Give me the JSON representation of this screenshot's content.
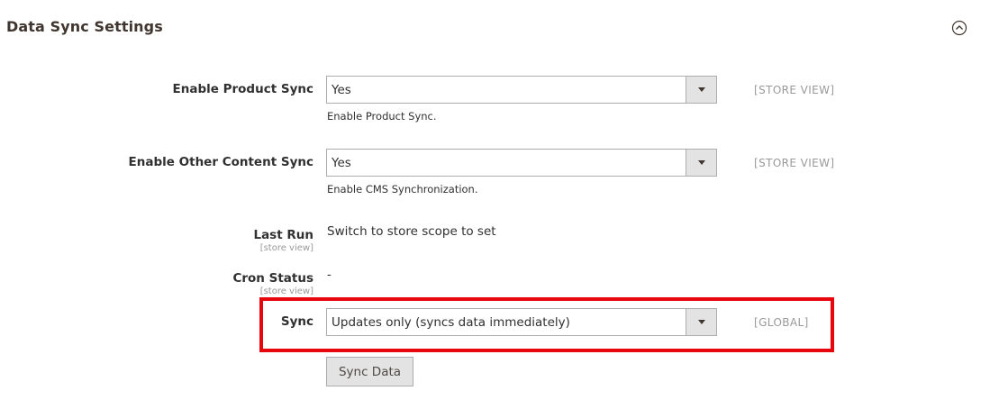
{
  "section": {
    "title": "Data Sync Settings",
    "collapse_icon": "chevron-up-circle-icon"
  },
  "rows": {
    "product_sync": {
      "label": "Enable Product Sync",
      "value": "Yes",
      "note": "Enable Product Sync.",
      "scope": "[STORE VIEW]"
    },
    "other_sync": {
      "label": "Enable Other Content Sync",
      "value": "Yes",
      "note": "Enable CMS Synchronization.",
      "scope": "[STORE VIEW]"
    },
    "last_run": {
      "label": "Last Run",
      "scope_note": "[store view]",
      "value": "Switch to store scope to set"
    },
    "cron_status": {
      "label": "Cron Status",
      "scope_note": "[store view]",
      "value": "-"
    },
    "sync": {
      "label": "Sync",
      "value": "Updates only (syncs data immediately)",
      "scope": "[GLOBAL]"
    }
  },
  "actions": {
    "sync_data_label": "Sync Data"
  },
  "colors": {
    "highlight": "#e8060d",
    "button_bg": "#e3e3e3",
    "muted_text": "#999999"
  }
}
